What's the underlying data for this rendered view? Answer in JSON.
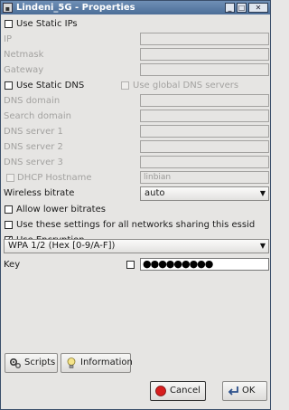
{
  "window": {
    "title": "Lindeni_5G - Properties"
  },
  "static_ips": {
    "label": "Use Static IPs",
    "checked": false,
    "fields": [
      {
        "label": "IP",
        "value": ""
      },
      {
        "label": "Netmask",
        "value": ""
      },
      {
        "label": "Gateway",
        "value": ""
      }
    ]
  },
  "static_dns": {
    "label": "Use Static DNS",
    "checked": false,
    "global_label": "Use global DNS servers",
    "global_checked": false,
    "fields": [
      {
        "label": "DNS domain",
        "value": ""
      },
      {
        "label": "Search domain",
        "value": ""
      },
      {
        "label": "DNS server 1",
        "value": ""
      },
      {
        "label": "DNS server 2",
        "value": ""
      },
      {
        "label": "DNS server 3",
        "value": ""
      }
    ]
  },
  "dhcp": {
    "label": "DHCP Hostname",
    "checked": false,
    "value": "linbian"
  },
  "bitrate": {
    "label": "Wireless bitrate",
    "value": "auto"
  },
  "options": {
    "allow_lower": {
      "label": "Allow lower bitrates",
      "checked": false
    },
    "same_essid": {
      "label": "Use these settings for all networks sharing this essid",
      "checked": false
    },
    "encryption": {
      "label": "Use Encryption",
      "checked": true
    }
  },
  "encryption_type": {
    "value": "WPA 1/2 (Hex [0-9/A-F])"
  },
  "key": {
    "label": "Key",
    "show_checked": false,
    "value": "●●●●●●●●●"
  },
  "buttons": {
    "scripts": "Scripts",
    "information": "Information",
    "cancel": "Cancel",
    "ok": "OK"
  }
}
